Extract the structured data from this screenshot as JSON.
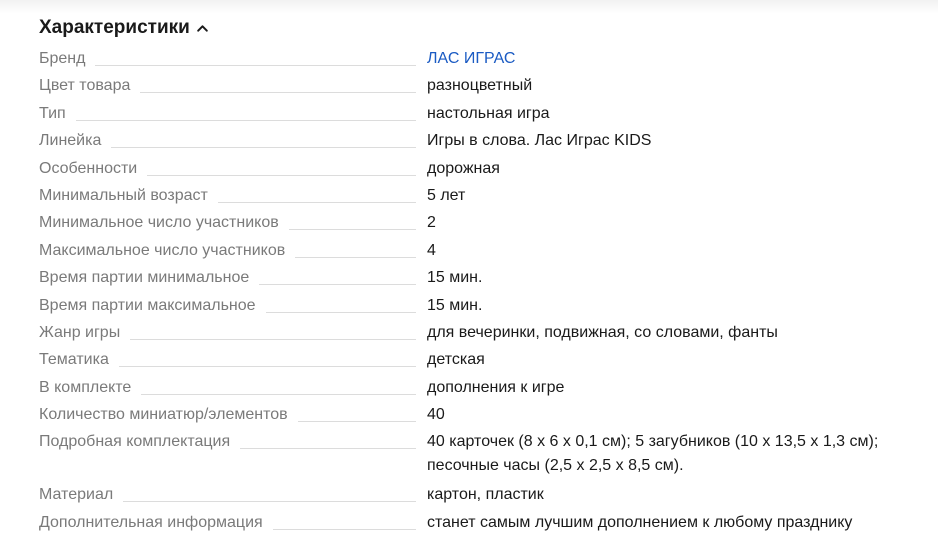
{
  "section": {
    "title": "Характеристики",
    "toggle_icon": "chevron-up-icon"
  },
  "specs": [
    {
      "label": "Бренд",
      "value": "ЛАС ИГРАС",
      "link": true
    },
    {
      "label": "Цвет товара",
      "value": "разноцветный"
    },
    {
      "label": "Тип",
      "value": "настольная игра"
    },
    {
      "label": "Линейка",
      "value": "Игры в слова. Лас Играс KIDS"
    },
    {
      "label": "Особенности",
      "value": "дорожная"
    },
    {
      "label": "Минимальный возраст",
      "value": "5 лет"
    },
    {
      "label": "Минимальное число участников",
      "value": "2"
    },
    {
      "label": "Максимальное число участников",
      "value": "4"
    },
    {
      "label": "Время партии минимальное",
      "value": "15 мин."
    },
    {
      "label": "Время партии максимальное",
      "value": "15 мин."
    },
    {
      "label": "Жанр игры",
      "value": "для вечеринки, подвижная, со словами, фанты"
    },
    {
      "label": "Тематика",
      "value": "детская"
    },
    {
      "label": "В комплекте",
      "value": "дополнения к игре"
    },
    {
      "label": "Количество миниатюр/элементов",
      "value": "40"
    },
    {
      "label": "Подробная комплектация",
      "value": "40 карточек (8 х 6 х 0,1 см); 5 загубников (10 х 13,5 х 1,3 см);\nпесочные часы (2,5 х 2,5 х 8,5 см).",
      "multiline": true
    },
    {
      "label": "Материал",
      "value": "картон, пластик"
    },
    {
      "label": "Дополнительная информация",
      "value": "станет самым лучшим дополнением к любому празднику"
    }
  ],
  "colors": {
    "label": "#7a7a7a",
    "value": "#1a1a1a",
    "link": "#1b5bc3",
    "leader": "#dcdcdc"
  }
}
